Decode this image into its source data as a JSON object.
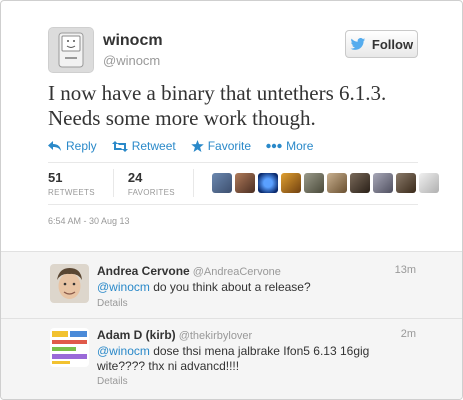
{
  "tweet": {
    "user": {
      "name": "winocm",
      "handle": "@winocm"
    },
    "follow_label": "Follow",
    "text_line1": "I now have a binary that untethers 6.1.3.",
    "text_line2": "Needs some more work though.",
    "actions": {
      "reply": "Reply",
      "retweet": "Retweet",
      "favorite": "Favorite",
      "more": "More"
    },
    "stats": {
      "retweets_count": "51",
      "retweets_label": "RETWEETS",
      "favorites_count": "24",
      "favorites_label": "FAVORITES"
    },
    "timestamp": "6:54 AM - 30 Aug 13"
  },
  "replies": [
    {
      "name": "Andrea Cervone",
      "handle": "@AndreaCervone",
      "time": "13m",
      "mention": "@winocm",
      "text": " do you think about a release?",
      "details": "Details"
    },
    {
      "name": "Adam D (kirb)",
      "handle": "@thekirbylover",
      "time": "2m",
      "mention": "@winocm",
      "text": " dose thsi mena jalbrake Ifon5 6.13 16gig wite???? thx ni advancd!!!!",
      "details": "Details"
    }
  ],
  "colors": {
    "link": "#2a89c9",
    "twitter_bird": "#55acee",
    "muted": "#999999"
  },
  "icons": [
    "classic-mac-avatar",
    "twitter-bird-icon",
    "reply-icon",
    "retweet-icon",
    "favorite-star-icon",
    "more-dots-icon"
  ]
}
